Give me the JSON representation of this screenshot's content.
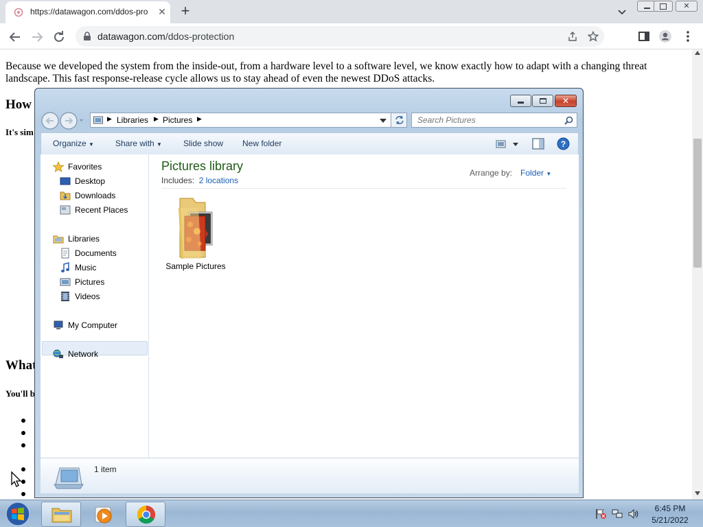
{
  "browser": {
    "tab_title": "https://datawagon.com/ddos-pro",
    "url_host": "datawagon.com",
    "url_path": "/ddos-protection"
  },
  "webpage": {
    "paragraph": "Because we developed the system from the inside-out, from a hardware level to a software level, we know exactly how to adapt with a changing threat landscape. This fast response-release cycle allows us to stay ahead of even the newest DDoS attacks.",
    "heading_1": "How",
    "bold_1": "It's sim",
    "heading_2": "What",
    "bold_2": "You'll b"
  },
  "explorer": {
    "breadcrumb": [
      "Libraries",
      "Pictures"
    ],
    "search_placeholder": "Search Pictures",
    "commands": [
      "Organize",
      "Share with",
      "Slide show",
      "New folder"
    ],
    "nav": {
      "favorites": "Favorites",
      "favorites_items": [
        "Desktop",
        "Downloads",
        "Recent Places"
      ],
      "libraries": "Libraries",
      "libraries_items": [
        "Documents",
        "Music",
        "Pictures",
        "Videos"
      ],
      "selected": "Pictures",
      "computer": "My Computer",
      "network": "Network"
    },
    "library_title": "Pictures library",
    "includes_label": "Includes:",
    "includes_link": "2 locations",
    "arrange_label": "Arrange by:",
    "arrange_value": "Folder",
    "items": [
      {
        "name": "Sample Pictures",
        "icon": "folder-icon"
      }
    ],
    "item_count": "1 item"
  },
  "taskbar": {
    "time": "6:45 PM",
    "date": "5/21/2022",
    "pinned": [
      "explorer-icon",
      "media-player-icon",
      "chrome-icon"
    ]
  },
  "colors": {
    "library_title": "#1e5c14",
    "link": "#1a5fb4",
    "taskbar": "#a9c2dc"
  }
}
